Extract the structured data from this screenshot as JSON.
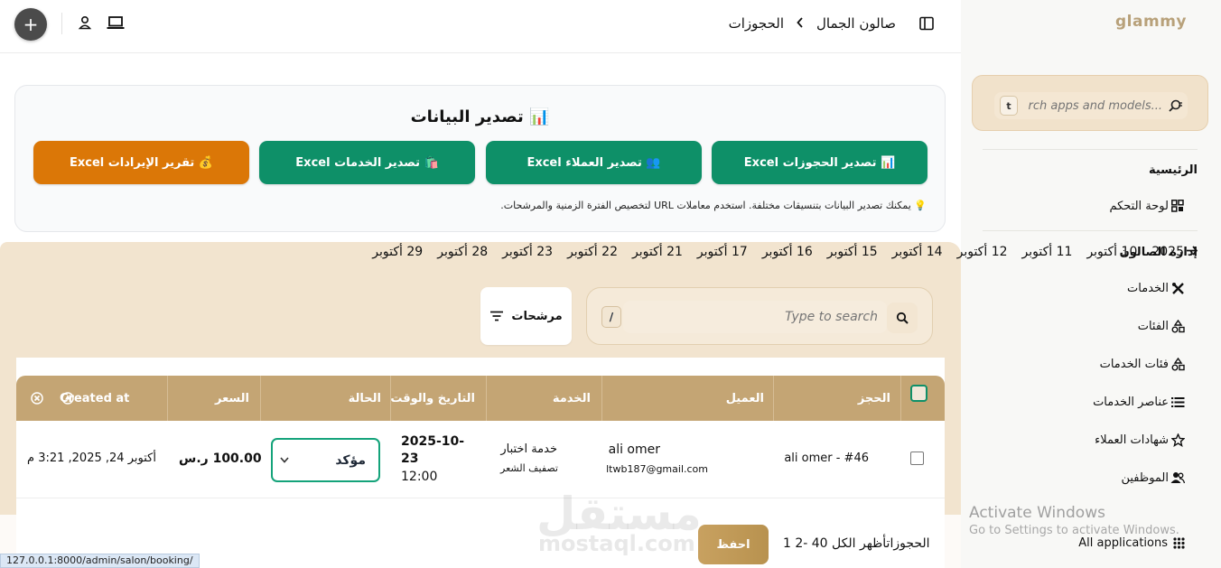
{
  "app": {
    "logo": "glammy"
  },
  "sidebar": {
    "search_placeholder": "rch apps and models...",
    "search_shortcut": "t",
    "section_home": "الرئيسية",
    "dashboard": "لوحة التحكم",
    "section_salon": "إدارة الصالون",
    "items": [
      {
        "label": "الخدمات",
        "icon": "tools-icon"
      },
      {
        "label": "الفئات",
        "icon": "shapes-icon"
      },
      {
        "label": "فئات الخدمات",
        "icon": "shapes-icon"
      },
      {
        "label": "عناصر الخدمات",
        "icon": "list-icon"
      },
      {
        "label": "شهادات العملاء",
        "icon": "star-icon"
      },
      {
        "label": "الموظفين",
        "icon": "users-icon"
      }
    ],
    "all_applications": "All applications"
  },
  "windows": {
    "activate_title": "Activate Windows",
    "activate_sub": "Go to Settings to activate Windows."
  },
  "header": {
    "breadcrumb_root": "صالون الجمال",
    "breadcrumb_current": "الحجوزات",
    "plus": "+"
  },
  "export": {
    "title": "📊 تصدير البيانات",
    "buttons": [
      {
        "label": "📊 تصدير الحجوزات Excel",
        "color": "#0e9068"
      },
      {
        "label": "👥 تصدير العملاء Excel",
        "color": "#0e9068"
      },
      {
        "label": "🛍️ تصدير الخدمات Excel",
        "color": "#0e9068"
      },
      {
        "label": "💰 تقرير الإيرادات Excel",
        "color": "#db7707"
      }
    ],
    "hint": "💡 يمكنك تصدير البيانات بتنسيقات مختلفة. استخدم معاملات URL لتخصيص الفترة الزمنية والمرشحات."
  },
  "dates": {
    "year": "2025",
    "items": [
      "10 أكتوبر",
      "11 أكتوبر",
      "12 أكتوبر",
      "14 أكتوبر",
      "15 أكتوبر",
      "16 أكتوبر",
      "17 أكتوبر",
      "21 أكتوبر",
      "22 أكتوبر",
      "23 أكتوبر",
      "28 أكتوبر",
      "29 أكتوبر"
    ]
  },
  "table_search": {
    "placeholder": "Type to search",
    "shortcut": "/"
  },
  "filters": {
    "label": "مرشحات"
  },
  "table": {
    "columns": {
      "booking": "الحجز",
      "client": "العميل",
      "service": "الخدمة",
      "datetime": "التاريخ والوقت",
      "status": "الحالة",
      "price": "السعر",
      "created": "Created at"
    },
    "rows": [
      {
        "booking": "ali omer - #46",
        "client_name": "ali omer",
        "client_email": "ltwb187@gmail.com",
        "service_name": "خدمة اختبار",
        "service_cat": "تصفيف الشعر",
        "date": "2025-10-23",
        "date_line1": "2025-10-",
        "date_line2": "23",
        "time": "12:00",
        "status": "مؤكد",
        "price": "100.00 ر.س",
        "created": "أكتوبر 24, 2025, 3:21 م"
      }
    ]
  },
  "footer": {
    "save": "احفظ",
    "pager": "1  2- 40 الحجوزاتأظهر الكل"
  },
  "watermark": {
    "arabic": "مستقل",
    "latin": "mostaql.com"
  },
  "status_url": "127.0.0.1:8000/admin/salon/booking/"
}
